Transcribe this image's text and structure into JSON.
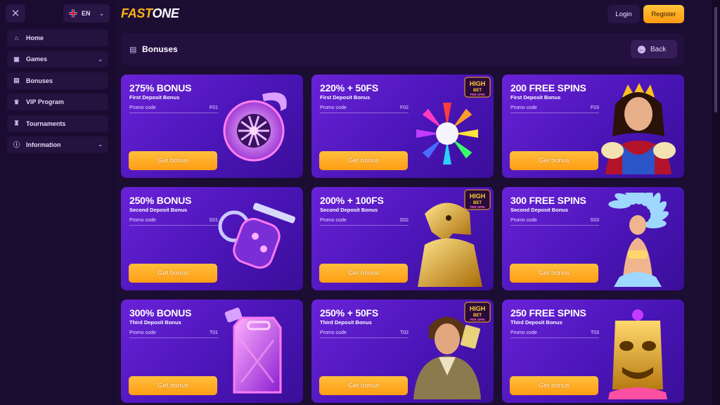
{
  "sidebar": {
    "lang": "EN",
    "items": [
      {
        "label": "Home",
        "icon": "home-icon",
        "glyph": "⌂",
        "chevron": false
      },
      {
        "label": "Games",
        "icon": "games-icon",
        "glyph": "▣",
        "chevron": true
      },
      {
        "label": "Bonuses",
        "icon": "gift-icon",
        "glyph": "▤",
        "chevron": false
      },
      {
        "label": "VIP Program",
        "icon": "crown-icon",
        "glyph": "♛",
        "chevron": false
      },
      {
        "label": "Tournaments",
        "icon": "trophy-icon",
        "glyph": "♜",
        "chevron": false
      },
      {
        "label": "Information",
        "icon": "info-icon",
        "glyph": "ⓘ",
        "chevron": true
      }
    ]
  },
  "header": {
    "logo_fast": "FAST",
    "logo_one": "ONE",
    "login_label": "Login",
    "register_label": "Register"
  },
  "page": {
    "title": "Bonuses",
    "back_label": "Back"
  },
  "colors": {
    "accent": "#ffa81e",
    "background": "#1c0d33",
    "card": "#5a1bc8"
  },
  "cards": [
    {
      "title": "275% BONUS",
      "subtitle": "First Deposit Bonus",
      "promo_label": "Promo code",
      "code": "F01",
      "button": "Get bonus",
      "art": "turbo-icon",
      "badge": null
    },
    {
      "title": "220% + 50FS",
      "subtitle": "First Deposit Bonus",
      "promo_label": "Promo code",
      "code": "F02",
      "button": "Get bonus",
      "art": "gem-star-icon",
      "badge": "HIGH BET PER SPIN"
    },
    {
      "title": "200 FREE SPINS",
      "subtitle": "First Deposit Bonus",
      "promo_label": "Promo code",
      "code": "F03",
      "button": "Get bonus",
      "art": "queen-icon",
      "badge": null
    },
    {
      "title": "250% BONUS",
      "subtitle": "Second Deposit Bonus",
      "promo_label": "Promo code",
      "code": "S01",
      "button": "Get bonus",
      "art": "car-key-icon",
      "badge": null
    },
    {
      "title": "200% + 100FS",
      "subtitle": "Second Deposit Bonus",
      "promo_label": "Promo code",
      "code": "S02",
      "button": "Get bonus",
      "art": "falcon-statue-icon",
      "badge": "HIGH BET PER SPIN"
    },
    {
      "title": "300 FREE SPINS",
      "subtitle": "Second Deposit Bonus",
      "promo_label": "Promo code",
      "code": "S03",
      "button": "Get bonus",
      "art": "dancer-icon",
      "badge": null
    },
    {
      "title": "300% BONUS",
      "subtitle": "Third Deposit Bonus",
      "promo_label": "Promo code",
      "code": "T01",
      "button": "Get bonus",
      "art": "fuel-can-icon",
      "badge": null
    },
    {
      "title": "250% + 50FS",
      "subtitle": "Third Deposit Bonus",
      "promo_label": "Promo code",
      "code": "T02",
      "button": "Get bonus",
      "art": "explorer-icon",
      "badge": "HIGH BET PER SPIN"
    },
    {
      "title": "250 FREE SPINS",
      "subtitle": "Third Deposit Bonus",
      "promo_label": "Promo code",
      "code": "T03",
      "button": "Get bonus",
      "art": "tiki-mask-icon",
      "badge": null
    }
  ]
}
